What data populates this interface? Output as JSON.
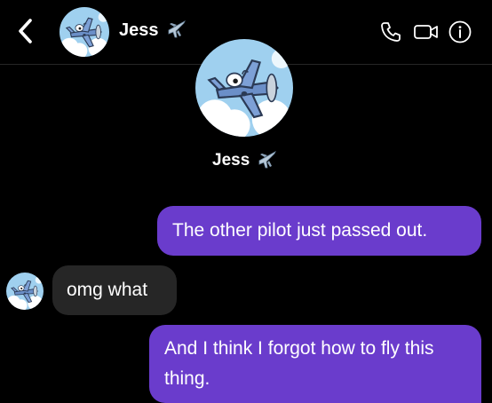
{
  "header": {
    "contact_name": "Jess",
    "contact_emoji": "airplane-emoji",
    "back_icon": "chevron-left-icon",
    "actions": [
      {
        "icon": "phone-icon"
      },
      {
        "icon": "video-camera-icon"
      },
      {
        "icon": "info-icon"
      }
    ]
  },
  "profile": {
    "name": "Jess",
    "emoji": "airplane-emoji"
  },
  "messages": [
    {
      "direction": "outgoing",
      "text": "The other pilot just passed out."
    },
    {
      "direction": "incoming",
      "text": "omg what"
    },
    {
      "direction": "outgoing",
      "text": "And I think I forgot how to fly this thing."
    }
  ],
  "colors": {
    "background": "#000000",
    "outgoing_bubble": "#6a3ccc",
    "incoming_bubble": "#262626",
    "text": "#ffffff"
  }
}
